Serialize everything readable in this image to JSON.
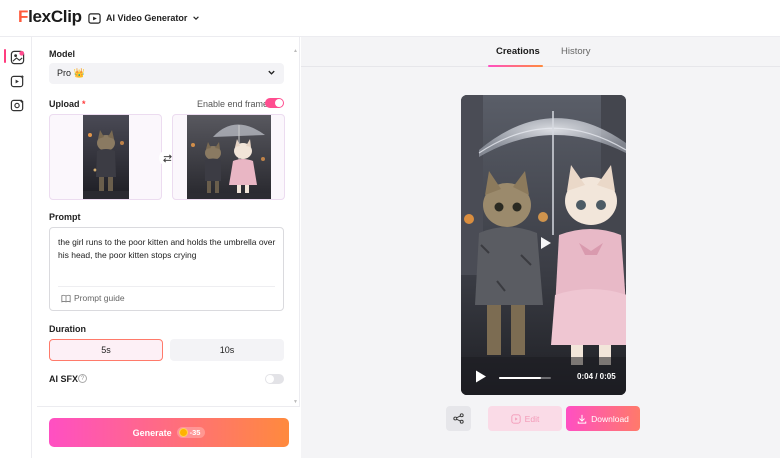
{
  "brand": {
    "logo_f": "F",
    "logo_rest": "lex",
    "logo_clip": "Clip"
  },
  "header": {
    "tool_name": "AI Video Generator",
    "tool_icon": "video-ai-icon"
  },
  "rail": {
    "items": [
      "image-to-video-icon",
      "text-to-video-icon",
      "video-effects-icon"
    ]
  },
  "settings": {
    "model_label": "Model",
    "model_value": "Pro 👑",
    "upload_label": "Upload",
    "upload_required": "*",
    "end_frame_label": "Enable end frame",
    "end_frame_enabled": true,
    "prompt_label": "Prompt",
    "prompt_text": "the girl runs to the poor kitten and holds the umbrella over his head, the poor kitten stops crying",
    "prompt_guide_label": "Prompt guide",
    "duration_label": "Duration",
    "durations": [
      "5s",
      "10s"
    ],
    "duration_selected": "5s",
    "ai_sfx_label": "AI SFX",
    "ai_sfx_info": "?",
    "ai_sfx_enabled": false,
    "generate_label": "Generate",
    "generate_cost": "-35"
  },
  "main": {
    "tabs": [
      "Creations",
      "History"
    ],
    "active_tab": "Creations",
    "video": {
      "current_time": "0:04",
      "duration": "0:05",
      "time_label": "0:04 / 0:05",
      "progress": 0.8
    },
    "edit_label": "Edit",
    "download_label": "Download"
  },
  "colors": {
    "accent_pink": "#ff4fc3",
    "accent_orange": "#ff8a3d",
    "toggle_on": "#ff4d8f"
  }
}
